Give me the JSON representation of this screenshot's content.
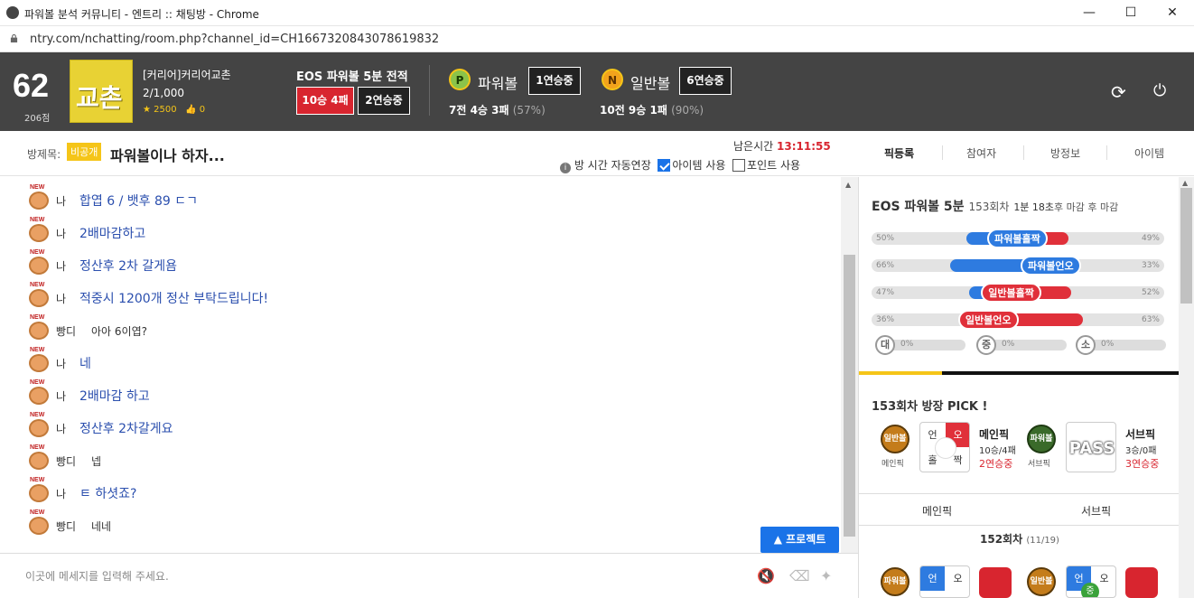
{
  "window": {
    "title": "파워볼 분석 커뮤니티 - 엔트리 :: 채팅방 - Chrome",
    "url": "ntry.com/nchatting/room.php?channel_id=CH1667320843078619832",
    "controls": {
      "minimize": "—",
      "maximize": "☐",
      "close": "✕"
    }
  },
  "header": {
    "level": "62",
    "points": "206점",
    "avatar_text": "교촌",
    "user_name": "[커리어]커리어교촌",
    "user_count": "2/1,000",
    "star_count": "2500",
    "like_count": "0",
    "eos_title": "EOS 파워볼 5분 전적",
    "eos_record": "10승 4패",
    "eos_streak": "2연승중",
    "powerball": {
      "badge": "P",
      "title": "파워볼",
      "streak": "1연승중",
      "record": "7전 4승 3패",
      "pct": "(57%)"
    },
    "normalball": {
      "badge": "N",
      "title": "일반볼",
      "streak": "6연승중",
      "record": "10전 9승 1패",
      "pct": "(90%)"
    },
    "refresh_icon": "⟳",
    "power_icon": "⏻"
  },
  "room": {
    "label": "방제목:",
    "privacy": "비공개",
    "title": "파워볼이나 하자...",
    "remain_label": "남은시간",
    "remain_time": "13:11:55",
    "auto_extend": "방 시간 자동연장",
    "item_use": "아이템 사용",
    "point_use": "포인트 사용"
  },
  "right_tabs": [
    "픽등록",
    "참여자",
    "방정보",
    "아이템"
  ],
  "messages": [
    {
      "sender": "나",
      "text": "합엽 6 / 뱃후 89 ㄷㄱ",
      "me": true
    },
    {
      "sender": "나",
      "text": "2배마감하고",
      "me": true
    },
    {
      "sender": "나",
      "text": "정산후 2차 갈게욤",
      "me": true
    },
    {
      "sender": "나",
      "text": "적중시 1200개 정산 부탁드립니다!",
      "me": true
    },
    {
      "sender": "빵디",
      "text": "아아 6이엽?",
      "me": false
    },
    {
      "sender": "나",
      "text": "네",
      "me": true
    },
    {
      "sender": "나",
      "text": "2배마감 하고",
      "me": true
    },
    {
      "sender": "나",
      "text": "정산후 2차갈게요",
      "me": true
    },
    {
      "sender": "빵디",
      "text": "넵",
      "me": false
    },
    {
      "sender": "나",
      "text": "ㅌ 하셧죠?",
      "me": true
    },
    {
      "sender": "빵디",
      "text": "네네",
      "me": false
    }
  ],
  "new_tag": "NEW",
  "protect_button": "▲ 프로젝트",
  "input": {
    "placeholder": "이곳에 메세지를 입력해 주세요.",
    "value": ""
  },
  "input_icons": {
    "mute": "🔇",
    "eraser": "⌫",
    "magic": "✦"
  },
  "game": {
    "title": "EOS 파워볼 5분",
    "round": "153회차",
    "time_prefix": "1분 18초",
    "time_suffix": "후 마감 후 마감",
    "bars": [
      {
        "label": "파워볼홀짝",
        "left_pct": 50,
        "right_pct": 49,
        "left_text": "50%",
        "right_text": "49%",
        "color": "#2e7be0"
      },
      {
        "label": "파워볼언오",
        "left_pct": 66,
        "right_pct": 33,
        "left_text": "66%",
        "right_text": "33%",
        "color": "#2e7be0"
      },
      {
        "label": "일반볼홀짝",
        "left_pct": 47,
        "right_pct": 52,
        "left_text": "47%",
        "right_text": "52%",
        "color": "#e0303a"
      },
      {
        "label": "일반볼언오",
        "left_pct": 36,
        "right_pct": 63,
        "left_text": "36%",
        "right_text": "63%",
        "color": "#e0303a"
      }
    ],
    "sizes": [
      {
        "label": "대",
        "pct": "0%"
      },
      {
        "label": "중",
        "pct": "0%"
      },
      {
        "label": "소",
        "pct": "0%"
      }
    ]
  },
  "pick": {
    "title": "153회차 방장 PICK !",
    "main": {
      "ball": "일반볼",
      "ball_caption": "메인픽",
      "cells": [
        "언",
        "오",
        "홀",
        "짝"
      ],
      "name": "메인픽",
      "record": "10승/4패",
      "streak": "2연승중"
    },
    "sub": {
      "ball": "파워볼",
      "ball_caption": "서브픽",
      "pass": "PASS",
      "name": "서브픽",
      "record": "3승/0패",
      "streak": "3연승중"
    }
  },
  "history": {
    "main_label": "메인픽",
    "sub_label": "서브픽",
    "round": "152회차",
    "date": "(11/19)",
    "row": {
      "ball1": "파워볼",
      "c1": [
        "언",
        "오"
      ],
      "ball2": "일반볼",
      "c2": [
        "언",
        "오"
      ],
      "mid": "중"
    }
  }
}
